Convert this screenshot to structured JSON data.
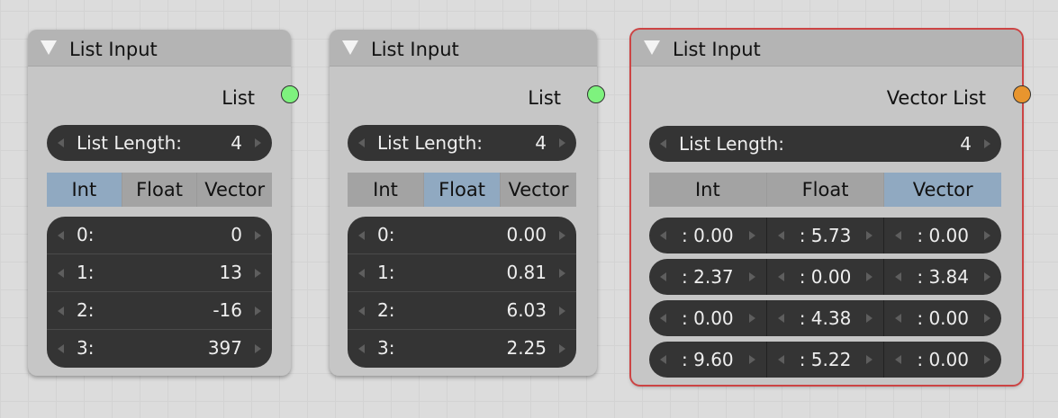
{
  "colors": {
    "int_socket": "#7ef27e",
    "vector_socket": "#e8952e",
    "tab_selected": "#90a9c1",
    "active_border": "#cc4444"
  },
  "nodes": [
    {
      "title": "List Input",
      "output_label": "List",
      "list_length_label": "List Length:",
      "list_length": "4",
      "tabs": [
        "Int",
        "Float",
        "Vector"
      ],
      "selected_tab": "Int",
      "rows": [
        {
          "label": "0:",
          "value": "0"
        },
        {
          "label": "1:",
          "value": "13"
        },
        {
          "label": "2:",
          "value": "-16"
        },
        {
          "label": "3:",
          "value": "397"
        }
      ]
    },
    {
      "title": "List Input",
      "output_label": "List",
      "list_length_label": "List Length:",
      "list_length": "4",
      "tabs": [
        "Int",
        "Float",
        "Vector"
      ],
      "selected_tab": "Float",
      "rows": [
        {
          "label": "0:",
          "value": "0.00"
        },
        {
          "label": "1:",
          "value": "0.81"
        },
        {
          "label": "2:",
          "value": "6.03"
        },
        {
          "label": "3:",
          "value": "2.25"
        }
      ]
    },
    {
      "title": "List Input",
      "output_label": "Vector List",
      "list_length_label": "List Length:",
      "list_length": "4",
      "tabs": [
        "Int",
        "Float",
        "Vector"
      ],
      "selected_tab": "Vector",
      "vectors": [
        [
          ": 0.00",
          ": 5.73",
          ": 0.00"
        ],
        [
          ": 2.37",
          ": 0.00",
          ": 3.84"
        ],
        [
          ": 0.00",
          ": 4.38",
          ": 0.00"
        ],
        [
          ": 9.60",
          ": 5.22",
          ": 0.00"
        ]
      ]
    }
  ]
}
